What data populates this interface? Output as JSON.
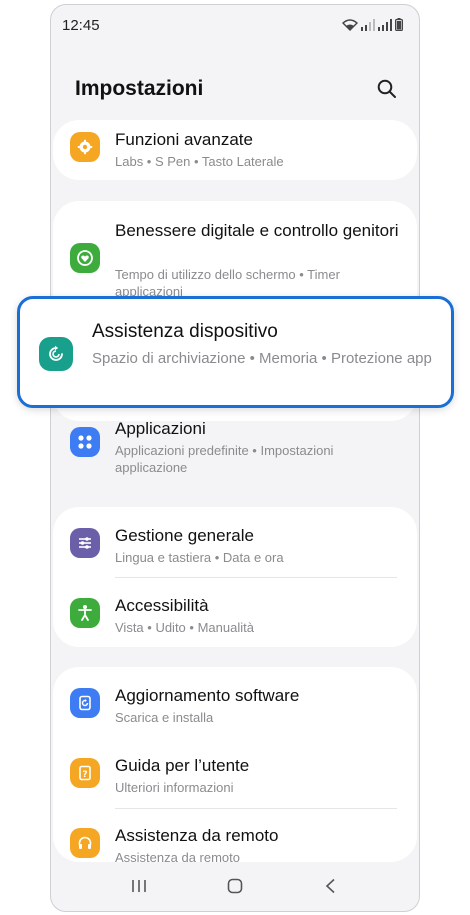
{
  "status_bar": {
    "time": "12:45"
  },
  "header": {
    "title": "Impostazioni"
  },
  "items": {
    "advanced": {
      "title": "Funzioni avanzate",
      "subtitle": "Labs  •  S Pen  •  Tasto Laterale",
      "color": "#f5a623"
    },
    "wellbeing": {
      "title": "Benessere digitale e controllo genitori",
      "subtitle": "Tempo di utilizzo dello schermo  •  Timer applicazioni",
      "color": "#3dac3d"
    },
    "device_care": {
      "title": "Assistenza dispositivo",
      "subtitle": "Spazio di archiviazione  •  Memoria  •  Protezione app",
      "color": "#19a08d"
    },
    "apps": {
      "title": "Applicazioni",
      "subtitle": "Applicazioni predefinite  •  Impostazioni applicazione",
      "color": "#3d7cf2"
    },
    "general": {
      "title": "Gestione generale",
      "subtitle": "Lingua e tastiera  •  Data e ora",
      "color": "#6a5fa8"
    },
    "accessibility": {
      "title": "Accessibilità",
      "subtitle": "Vista  •  Udito  •  Manualità",
      "color": "#3dac3d"
    },
    "software_update": {
      "title": "Aggiornamento software",
      "subtitle": "Scarica e installa",
      "color": "#3d7cf2"
    },
    "user_guide": {
      "title": "Guida per l’utente",
      "subtitle": "Ulteriori informazioni",
      "color": "#f5a623"
    },
    "remote_support": {
      "title": "Assistenza da remoto",
      "subtitle": "Assistenza da remoto",
      "color": "#f5a623"
    }
  },
  "icons": {
    "search": "search-icon",
    "recents": "recents-icon",
    "home": "home-icon",
    "back": "back-icon"
  }
}
